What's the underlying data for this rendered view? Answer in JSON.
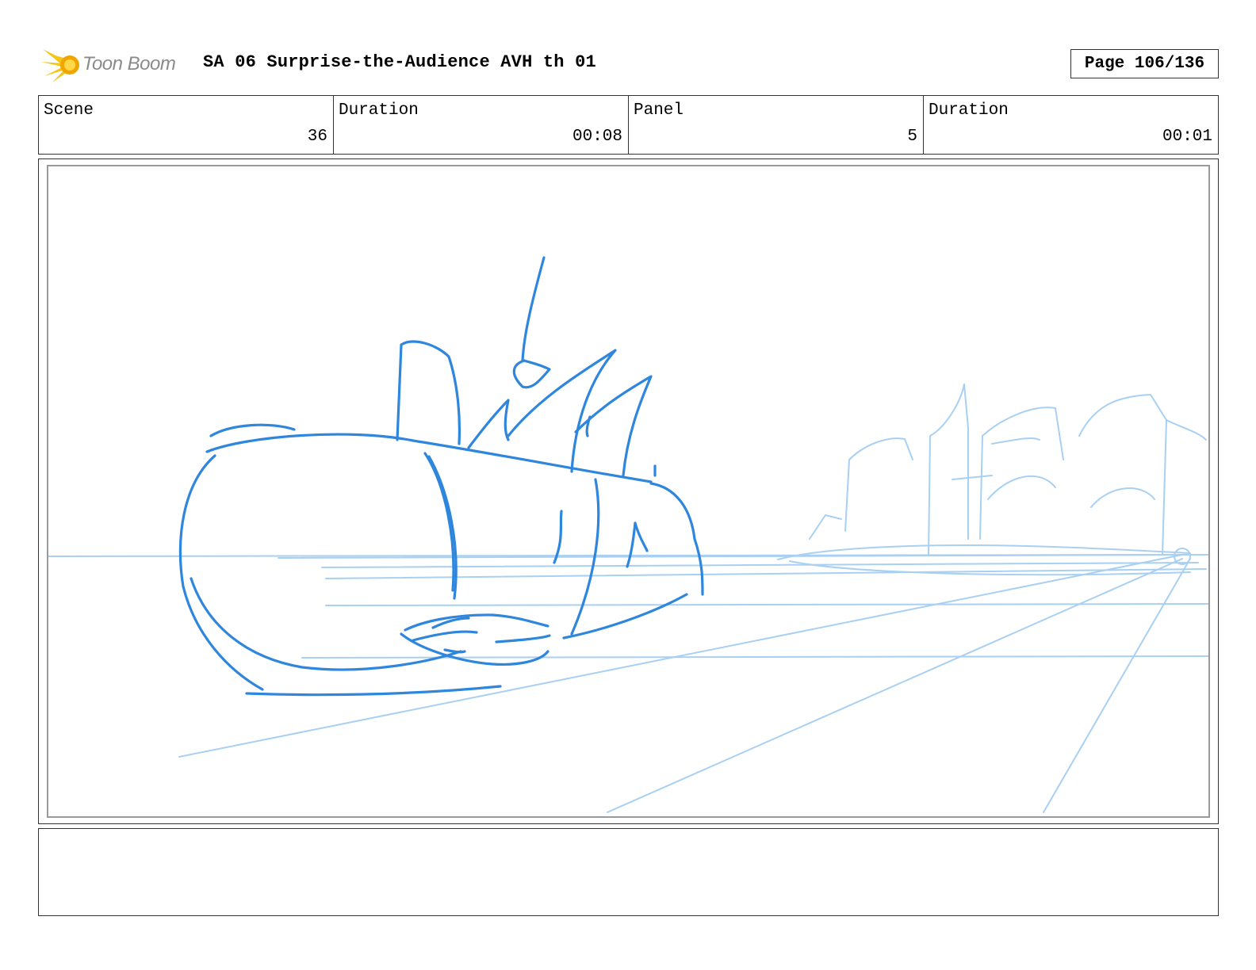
{
  "header": {
    "logo_text": "Toon Boom",
    "title": "SA 06 Surprise-the-Audience AVH th 01",
    "page": "Page 106/136"
  },
  "info": {
    "scene_label": "Scene",
    "scene_value": "36",
    "scene_duration_label": "Duration",
    "scene_duration_value": "00:08",
    "panel_label": "Panel",
    "panel_value": "5",
    "panel_duration_label": "Duration",
    "panel_duration_value": "00:01"
  },
  "colors": {
    "sketch_dark": "#2f86dd",
    "sketch_light": "#a9d0f2",
    "logo_yellow": "#f5c518",
    "logo_text": "#8a8a8a"
  },
  "icons": [
    "toon-boom-logo-icon"
  ]
}
